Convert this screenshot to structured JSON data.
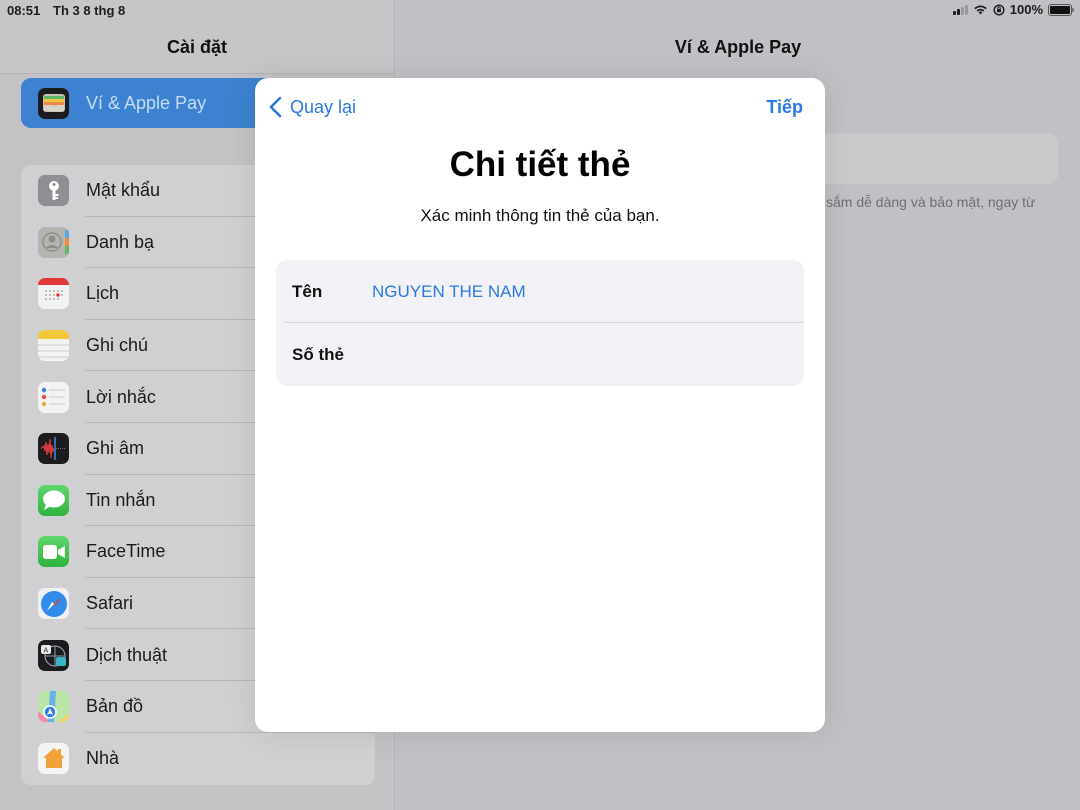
{
  "status_bar": {
    "time": "08:51",
    "date": "Th 3 8 thg 8",
    "battery_percent": "100%",
    "battery_level": 1.0,
    "signal_bars_active": 2,
    "signal_bars_total": 4,
    "icons": [
      "signal-icon",
      "wifi-icon",
      "orientation-lock-icon",
      "battery-icon"
    ]
  },
  "sidebar": {
    "title": "Cài đặt",
    "selected_item": {
      "label": "Ví & Apple Pay",
      "icon": "wallet-icon"
    },
    "items": [
      {
        "label": "Mật khẩu",
        "icon": "key-icon"
      },
      {
        "label": "Danh bạ",
        "icon": "contacts-icon"
      },
      {
        "label": "Lịch",
        "icon": "calendar-icon"
      },
      {
        "label": "Ghi chú",
        "icon": "notes-icon"
      },
      {
        "label": "Lời nhắc",
        "icon": "reminders-icon"
      },
      {
        "label": "Ghi âm",
        "icon": "voice-memos-icon"
      },
      {
        "label": "Tin nhắn",
        "icon": "messages-icon"
      },
      {
        "label": "FaceTime",
        "icon": "facetime-icon"
      },
      {
        "label": "Safari",
        "icon": "safari-icon"
      },
      {
        "label": "Dịch thuật",
        "icon": "translate-icon"
      },
      {
        "label": "Bản đồ",
        "icon": "maps-icon"
      },
      {
        "label": "Nhà",
        "icon": "home-icon"
      }
    ]
  },
  "detail": {
    "title": "Ví & Apple Pay",
    "note_partial": "sắm dễ dàng và bảo mật, ngay từ"
  },
  "modal": {
    "back_label": "Quay lại",
    "next_label": "Tiếp",
    "title": "Chi tiết thẻ",
    "subtitle": "Xác minh thông tin thẻ của bạn.",
    "fields": [
      {
        "label": "Tên",
        "value": "NGUYEN THE NAM",
        "placeholder": ""
      },
      {
        "label": "Số thẻ",
        "value": "",
        "placeholder": ""
      }
    ]
  },
  "colors": {
    "accent": "#2a7ae2",
    "selected_row": "#3d82d0"
  }
}
